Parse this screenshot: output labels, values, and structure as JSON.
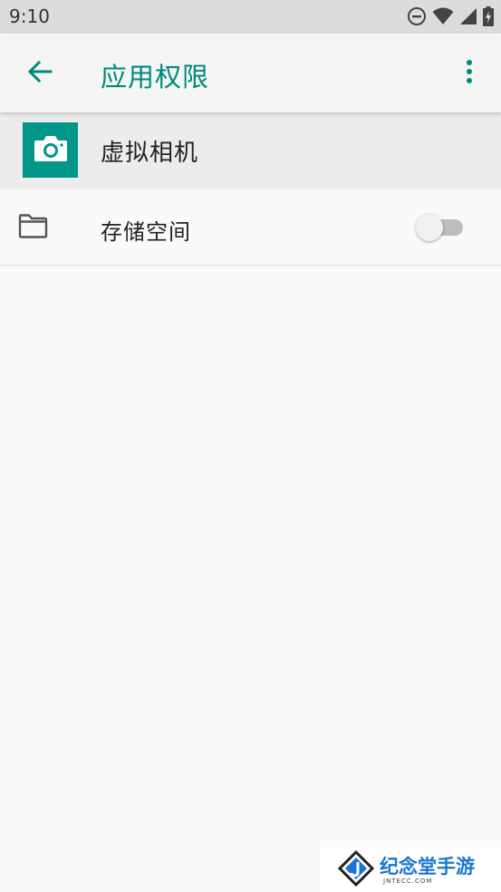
{
  "status_bar": {
    "time": "9:10",
    "icons": [
      "do-not-disturb-icon",
      "wifi-icon",
      "cellular-signal-icon",
      "battery-charging-icon"
    ]
  },
  "app_bar": {
    "title": "应用权限",
    "back_icon": "arrow-back-icon",
    "menu_icon": "more-vert-icon"
  },
  "app_header": {
    "app_name": "虚拟相机",
    "icon": "camera-icon"
  },
  "permissions": [
    {
      "label": "存储空间",
      "icon": "folder-icon",
      "enabled": false
    }
  ],
  "watermark": {
    "text_cn": "纪念堂手游",
    "text_en": "JNTECC.COM"
  },
  "colors": {
    "accent": "#00897b",
    "app_icon_bg": "#009688",
    "status_bar_bg": "#dcdcdc",
    "background": "#fafafa",
    "watermark_blue": "#1976d2"
  }
}
